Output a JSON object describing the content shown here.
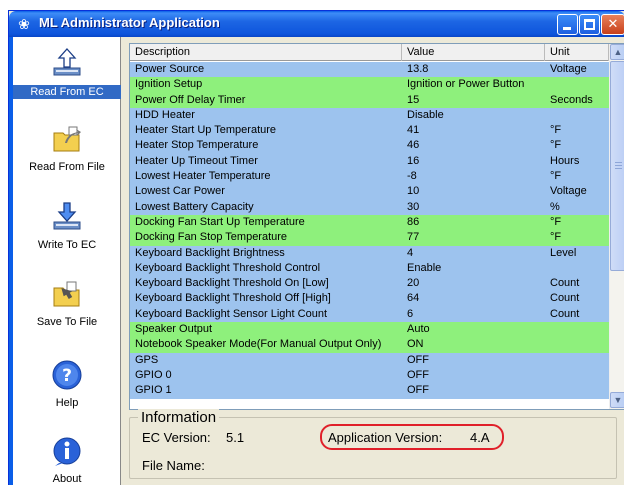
{
  "window": {
    "title": "ML Administrator Application"
  },
  "sidebar": {
    "items": [
      {
        "label": "Read From EC",
        "active": true,
        "icon": "upload-arrow-icon"
      },
      {
        "label": "Read From File",
        "active": false,
        "icon": "open-folder-icon"
      },
      {
        "label": "Write To EC",
        "active": false,
        "icon": "download-arrow-icon"
      },
      {
        "label": "Save To File",
        "active": false,
        "icon": "save-folder-icon"
      },
      {
        "label": "Help",
        "active": false,
        "icon": "help-icon"
      },
      {
        "label": "About",
        "active": false,
        "icon": "info-icon"
      }
    ]
  },
  "table": {
    "headers": [
      "Description",
      "Value",
      "Unit"
    ],
    "rows": [
      {
        "d": "Power Source",
        "v": "13.8",
        "u": "Voltage",
        "c": "blue"
      },
      {
        "d": "Ignition Setup",
        "v": "Ignition or Power Button",
        "u": "",
        "c": "green"
      },
      {
        "d": "Power Off Delay Timer",
        "v": "15",
        "u": "Seconds",
        "c": "green"
      },
      {
        "d": "HDD Heater",
        "v": "Disable",
        "u": "",
        "c": "blue"
      },
      {
        "d": "Heater Start Up Temperature",
        "v": "41",
        "u": "°F",
        "c": "blue"
      },
      {
        "d": "Heater Stop Temperature",
        "v": "46",
        "u": "°F",
        "c": "blue"
      },
      {
        "d": "Heater Up Timeout Timer",
        "v": "16",
        "u": "Hours",
        "c": "blue"
      },
      {
        "d": "Lowest Heater Temperature",
        "v": "-8",
        "u": "°F",
        "c": "blue"
      },
      {
        "d": "Lowest Car Power",
        "v": "10",
        "u": "Voltage",
        "c": "blue"
      },
      {
        "d": "Lowest Battery Capacity",
        "v": "30",
        "u": "%",
        "c": "blue"
      },
      {
        "d": "Docking Fan Start Up Temperature",
        "v": "86",
        "u": "°F",
        "c": "green"
      },
      {
        "d": "Docking Fan Stop Temperature",
        "v": "77",
        "u": "°F",
        "c": "green"
      },
      {
        "d": "Keyboard Backlight Brightness",
        "v": "4",
        "u": "Level",
        "c": "blue"
      },
      {
        "d": "Keyboard Backlight Threshold Control",
        "v": "Enable",
        "u": "",
        "c": "blue"
      },
      {
        "d": "Keyboard Backlight Threshold On [Low]",
        "v": "20",
        "u": "Count",
        "c": "blue"
      },
      {
        "d": "Keyboard Backlight Threshold Off [High]",
        "v": "64",
        "u": "Count",
        "c": "blue"
      },
      {
        "d": "Keyboard Backlight Sensor Light Count",
        "v": "6",
        "u": "Count",
        "c": "blue"
      },
      {
        "d": "Speaker Output",
        "v": "Auto",
        "u": "",
        "c": "green"
      },
      {
        "d": "Notebook Speaker Mode(For Manual Output Only)",
        "v": "ON",
        "u": "",
        "c": "green"
      },
      {
        "d": "GPS",
        "v": "OFF",
        "u": "",
        "c": "blue"
      },
      {
        "d": "GPIO 0",
        "v": "OFF",
        "u": "",
        "c": "blue"
      },
      {
        "d": "GPIO 1",
        "v": "OFF",
        "u": "",
        "c": "blue"
      }
    ]
  },
  "info": {
    "legend": "Information",
    "ec_version_label": "EC Version:",
    "ec_version_value": "5.1",
    "app_version_label": "Application Version:",
    "app_version_value": "4.A",
    "file_name_label": "File Name:"
  },
  "colors": {
    "row_blue": "#9dc3ee",
    "row_green": "#8ef07c",
    "highlight": "#e0202a",
    "titlebar": "#0a5ee8"
  }
}
